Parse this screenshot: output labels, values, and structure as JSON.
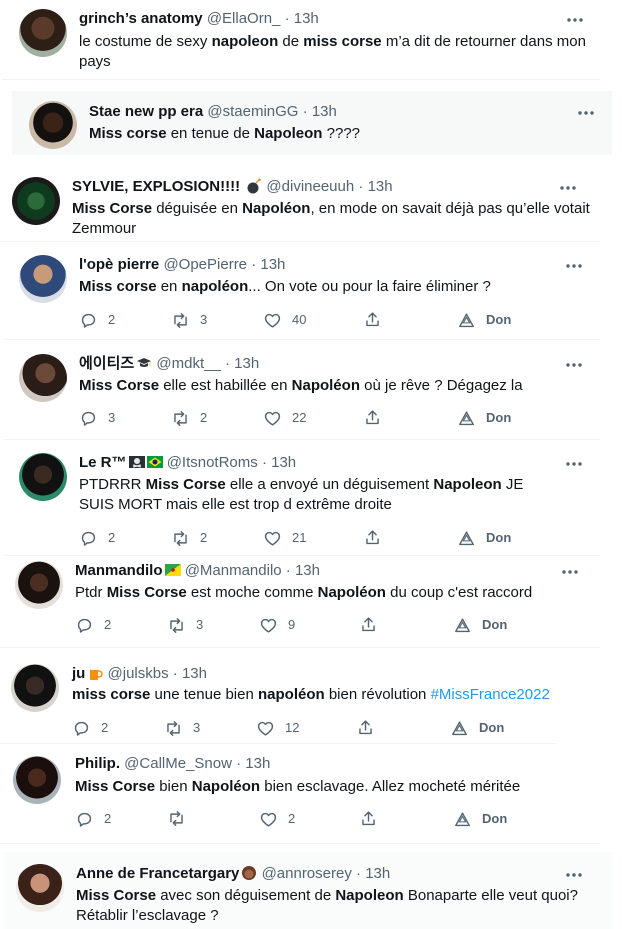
{
  "colors": {
    "accent": "#1d9bf0",
    "muted": "#536471",
    "text": "#0f1419",
    "panel": "#f7f9f9"
  },
  "tweets": [
    {
      "name": "grinch’s anatomy",
      "handle": "@EllaOrn_",
      "dot": "·",
      "time": "13h",
      "text": [
        [
          "le costume de sexy ",
          0
        ],
        [
          "napoleon",
          1
        ],
        [
          " de ",
          0
        ],
        [
          "miss corse",
          1
        ],
        [
          " m’a dit de retourner dans mon pays",
          0
        ]
      ]
    },
    {
      "name": "Stae new pp era",
      "handle": "@staeminGG",
      "dot": "·",
      "time": "13h",
      "text": [
        [
          "Miss corse",
          1
        ],
        [
          " en tenue de ",
          0
        ],
        [
          "Napoleon",
          1
        ],
        [
          " ????",
          0
        ]
      ]
    },
    {
      "name": "SYLVIE, EXPLOSION!!!! ",
      "emoji": "bomb-icon",
      "handle": "@divineeuuh",
      "dot": "·",
      "time": "13h",
      "text": [
        [
          "Miss Corse",
          1
        ],
        [
          " déguisée en ",
          0
        ],
        [
          "Napoléon",
          1
        ],
        [
          ", en mode on savait déjà pas qu’elle votait Zemmour",
          0
        ]
      ]
    },
    {
      "name": "l'opè pierre",
      "handle": "@OpePierre",
      "dot": "·",
      "time": "13h",
      "text": [
        [
          "Miss corse",
          1
        ],
        [
          " en ",
          0
        ],
        [
          "napoléon",
          1
        ],
        [
          "... On vote ou pour la faire éliminer ?",
          0
        ]
      ],
      "actions": {
        "reply": "2",
        "retweet": "3",
        "like": "40",
        "share": "",
        "promote": "Don"
      }
    },
    {
      "name": "에이티즈",
      "emoji": "grad-cap-icon",
      "handle": "@mdkt__",
      "dot": "·",
      "time": "13h",
      "text": [
        [
          "Miss Corse",
          1
        ],
        [
          " elle est habillée en ",
          0
        ],
        [
          "Napoléon",
          1
        ],
        [
          " où je rêve ? Dégagez la",
          0
        ]
      ],
      "actions": {
        "reply": "3",
        "retweet": "2",
        "like": "22",
        "share": "",
        "promote": "Don"
      }
    },
    {
      "name": "Le R™",
      "emoji": "skull-flag-icon",
      "emoji2": "brazil-flag-icon",
      "handle": "@ItsnotRoms",
      "dot": "·",
      "time": "13h",
      "text": [
        [
          "PTDRRR ",
          0
        ],
        [
          "Miss Corse",
          1
        ],
        [
          " elle a envoyé un déguisement ",
          0
        ],
        [
          "Napoleon",
          1
        ],
        [
          " JE SUIS MORT mais elle est trop d extrême droite",
          0
        ]
      ],
      "actions": {
        "reply": "2",
        "retweet": "2",
        "like": "21",
        "share": "",
        "promote": "Don"
      }
    },
    {
      "name": "Manmandilo",
      "emoji": "guiana-flag-icon",
      "handle": "@Manmandilo",
      "dot": "·",
      "time": "13h",
      "text": [
        [
          "Ptdr ",
          0
        ],
        [
          "Miss Corse",
          1
        ],
        [
          " est moche comme ",
          0
        ],
        [
          "Napoléon",
          1
        ],
        [
          " du coup c'est raccord",
          0
        ]
      ],
      "actions": {
        "reply": "2",
        "retweet": "3",
        "like": "9",
        "share": "",
        "promote": "Don"
      }
    },
    {
      "name": "ju",
      "emoji": "beer-icon",
      "handle": "@julskbs",
      "dot": "·",
      "time": "13h",
      "text": [
        [
          "miss corse",
          1
        ],
        [
          " une tenue bien ",
          0
        ],
        [
          "napoléon",
          1
        ],
        [
          " bien révolution ",
          0
        ],
        [
          "#MissFrance2022",
          2
        ]
      ],
      "actions": {
        "reply": "2",
        "retweet": "3",
        "like": "12",
        "share": "",
        "promote": "Don"
      }
    },
    {
      "name": "Philip.",
      "handle": "@CallMe_Snow",
      "dot": "·",
      "time": "13h",
      "text": [
        [
          "Miss Corse",
          1
        ],
        [
          " bien ",
          0
        ],
        [
          "Napoléon",
          1
        ],
        [
          " bien esclavage. Allez mocheté méritée",
          0
        ]
      ],
      "actions": {
        "reply": "2",
        "retweet": "",
        "like": "2",
        "share": "",
        "promote": "Don"
      }
    },
    {
      "name": "Anne de Francetargary",
      "emoji": "woman-icon",
      "handle": "@annroserey",
      "dot": "·",
      "time": "13h",
      "text": [
        [
          "Miss Corse",
          1
        ],
        [
          " avec son déguisement de ",
          0
        ],
        [
          "Napoleon",
          1
        ],
        [
          " Bonaparte elle veut quoi? Rétablir l’esclavage ?",
          0
        ]
      ]
    }
  ]
}
